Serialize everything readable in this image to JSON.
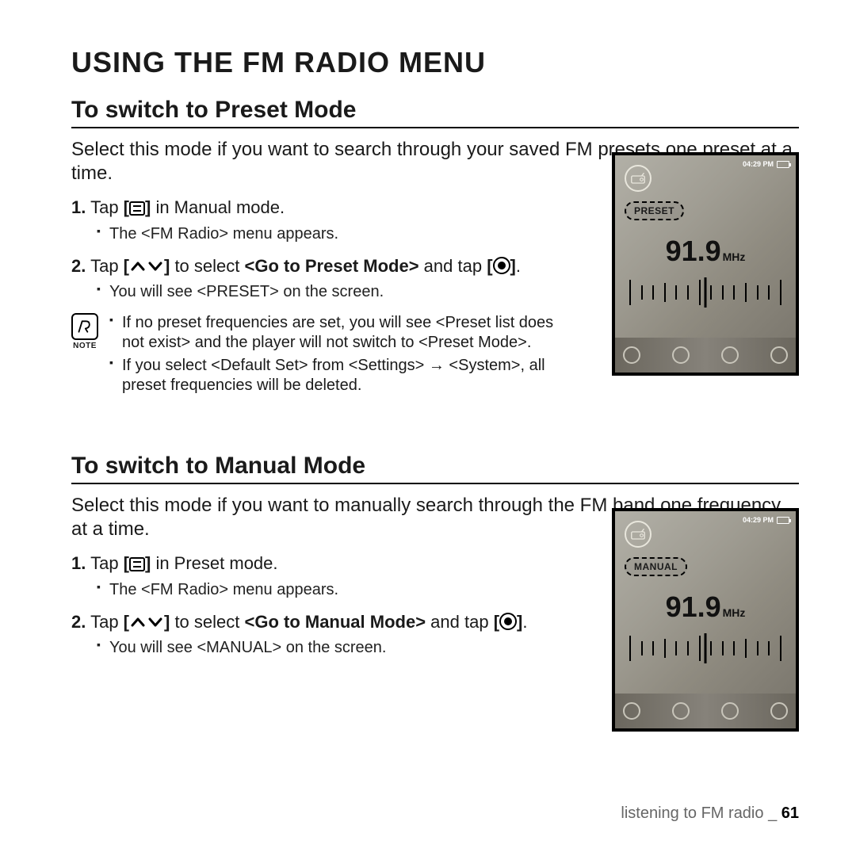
{
  "title": "USING THE FM RADIO MENU",
  "footer": {
    "section": "listening to FM radio",
    "sep": "_",
    "page": "61"
  },
  "note_label": "NOTE",
  "device": {
    "time": "04:29 PM",
    "freq_value": "91.9",
    "freq_unit": "MHz"
  },
  "preset": {
    "heading": "To switch to Preset Mode",
    "intro": "Select this mode if you want to search through your saved FM presets one preset at a time.",
    "badge": "PRESET",
    "step1_a": "Tap ",
    "step1_b": " in Manual mode.",
    "step1_sub": "The <FM Radio> menu appears.",
    "step2_a": "Tap ",
    "step2_b": " to select ",
    "step2_bold": "<Go to Preset Mode>",
    "step2_c": " and tap ",
    "step2_sub": "You will see <PRESET> on the screen.",
    "note1": "If no preset frequencies are set, you will see <Preset list does not exist> and the player will not switch to <Preset Mode>.",
    "note2": "If you select <Default Set> from <Settings> → <System>, all preset frequencies will be deleted."
  },
  "manual": {
    "heading": "To switch to Manual Mode",
    "intro": "Select this mode if you want to manually search through the FM band one frequency at a time.",
    "badge": "MANUAL",
    "step1_a": "Tap ",
    "step1_b": " in Preset mode.",
    "step1_sub": "The <FM Radio> menu appears.",
    "step2_a": "Tap ",
    "step2_b": " to select ",
    "step2_bold": "<Go to Manual Mode>",
    "step2_c": " and tap ",
    "step2_sub": "You will see <MANUAL> on the screen."
  }
}
